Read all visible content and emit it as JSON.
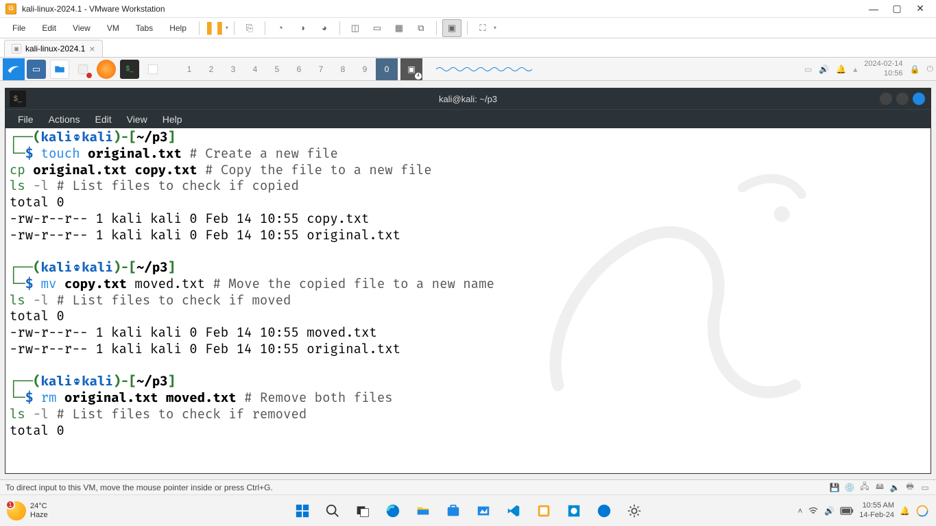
{
  "vmware": {
    "title": "kali-linux-2024.1 - VMware Workstation",
    "menu": [
      "File",
      "Edit",
      "View",
      "VM",
      "Tabs",
      "Help"
    ],
    "tab": {
      "label": "kali-linux-2024.1"
    },
    "status_text": "To direct input to this VM, move the mouse pointer inside or press Ctrl+G."
  },
  "kali_panel": {
    "workspaces": [
      "1",
      "2",
      "3",
      "4",
      "5",
      "6",
      "7",
      "8",
      "9",
      "0"
    ],
    "active_ws": "0",
    "terminal_badge": "4",
    "date": "2024-02-14",
    "time": "10:56"
  },
  "terminal": {
    "title": "kali@kali: ~/p3",
    "menu": [
      "File",
      "Actions",
      "Edit",
      "View",
      "Help"
    ],
    "prompt": {
      "user": "kali",
      "host": "kali",
      "path": "~/p3"
    },
    "blocks": [
      {
        "cmd": {
          "name": "touch",
          "args_bold": "original.txt",
          "comment": "# Create a new file"
        },
        "extra": [
          {
            "type": "cp",
            "args_bold": "original.txt copy.txt",
            "comment": "# Copy the file to a new file"
          },
          {
            "type": "ls",
            "opt": "-l",
            "comment": "# List files to check if copied"
          }
        ],
        "output": [
          "total 0",
          "-rw-r--r-- 1 kali kali 0 Feb 14 10:55 copy.txt",
          "-rw-r--r-- 1 kali kali 0 Feb 14 10:55 original.txt"
        ]
      },
      {
        "cmd": {
          "name": "mv",
          "args_bold": "copy.txt",
          "args_plain": "moved.txt",
          "comment": "# Move the copied file to a new name"
        },
        "extra": [
          {
            "type": "ls",
            "opt": "-l",
            "comment": "# List files to check if moved"
          }
        ],
        "output": [
          "total 0",
          "-rw-r--r-- 1 kali kali 0 Feb 14 10:55 moved.txt",
          "-rw-r--r-- 1 kali kali 0 Feb 14 10:55 original.txt"
        ]
      },
      {
        "cmd": {
          "name": "rm",
          "args_bold": "original.txt moved.txt",
          "comment": "# Remove both files"
        },
        "extra": [
          {
            "type": "ls",
            "opt": "-l",
            "comment": "# List files to check if removed"
          }
        ],
        "output": [
          "total 0"
        ]
      }
    ]
  },
  "windows": {
    "weather": {
      "temp": "24°C",
      "desc": "Haze",
      "alert": "1"
    },
    "clock": {
      "time": "10:55 AM",
      "date": "14-Feb-24"
    }
  }
}
